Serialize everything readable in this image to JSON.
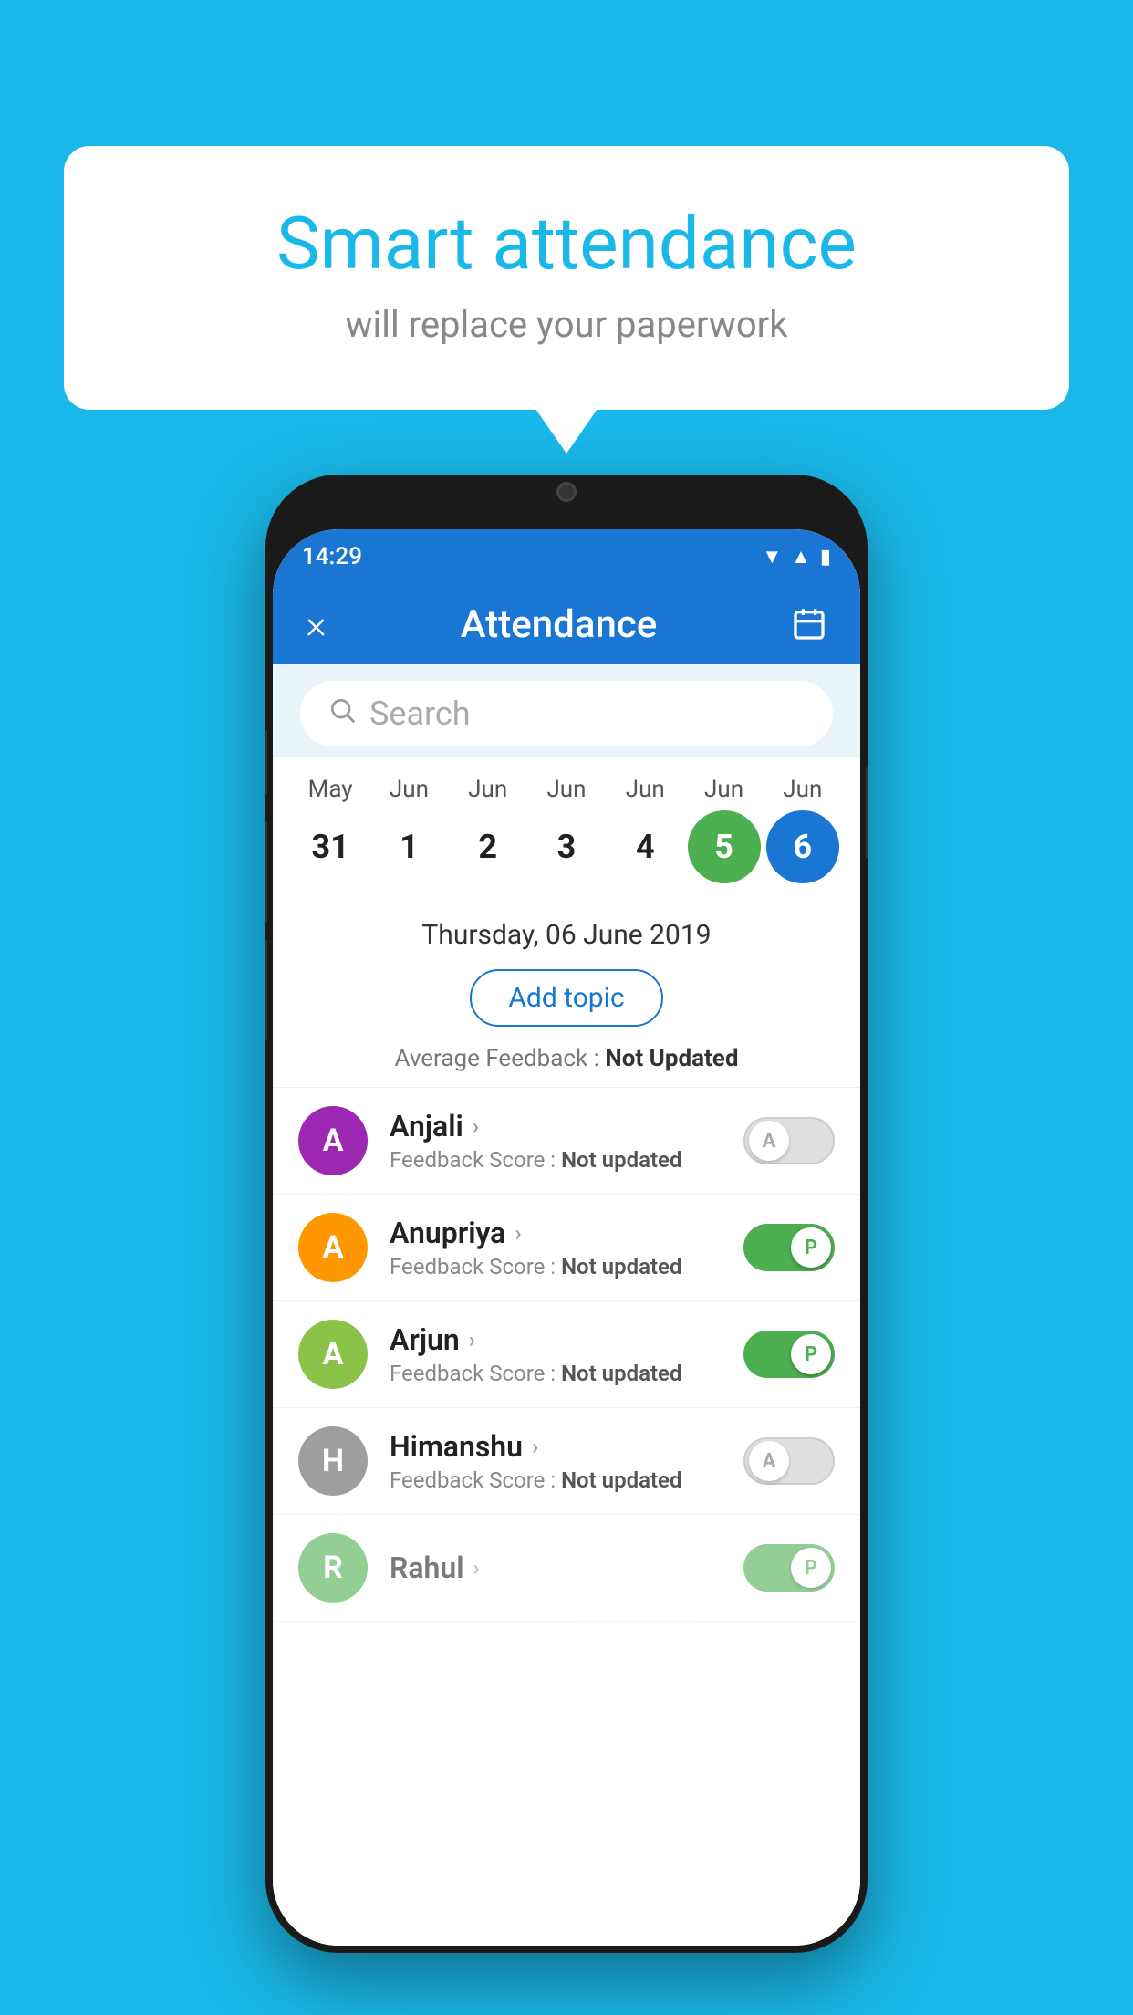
{
  "background_color": "#1ab8e8",
  "bubble": {
    "title": "Smart attendance",
    "subtitle": "will replace your paperwork"
  },
  "status_bar": {
    "time": "14:29",
    "icons": [
      "wifi",
      "signal",
      "battery"
    ]
  },
  "header": {
    "title": "Attendance",
    "close_label": "×",
    "calendar_label": "📅"
  },
  "search": {
    "placeholder": "Search"
  },
  "calendar": {
    "months": [
      "May",
      "Jun",
      "Jun",
      "Jun",
      "Jun",
      "Jun",
      "Jun"
    ],
    "dates": [
      "31",
      "1",
      "2",
      "3",
      "4",
      "5",
      "6"
    ],
    "selected_green_index": 5,
    "selected_blue_index": 6
  },
  "selected_date": {
    "text": "Thursday, 06 June 2019",
    "add_topic_label": "Add topic",
    "avg_feedback_label": "Average Feedback :",
    "avg_feedback_value": "Not Updated"
  },
  "students": [
    {
      "name": "Anjali",
      "avatar_letter": "A",
      "avatar_color": "#9c27b0",
      "feedback_label": "Feedback Score :",
      "feedback_value": "Not updated",
      "status": "absent"
    },
    {
      "name": "Anupriya",
      "avatar_letter": "A",
      "avatar_color": "#ff9800",
      "feedback_label": "Feedback Score :",
      "feedback_value": "Not updated",
      "status": "present"
    },
    {
      "name": "Arjun",
      "avatar_letter": "A",
      "avatar_color": "#8bc34a",
      "feedback_label": "Feedback Score :",
      "feedback_value": "Not updated",
      "status": "present"
    },
    {
      "name": "Himanshu",
      "avatar_letter": "H",
      "avatar_color": "#9e9e9e",
      "feedback_label": "Feedback Score :",
      "feedback_value": "Not updated",
      "status": "absent"
    }
  ]
}
